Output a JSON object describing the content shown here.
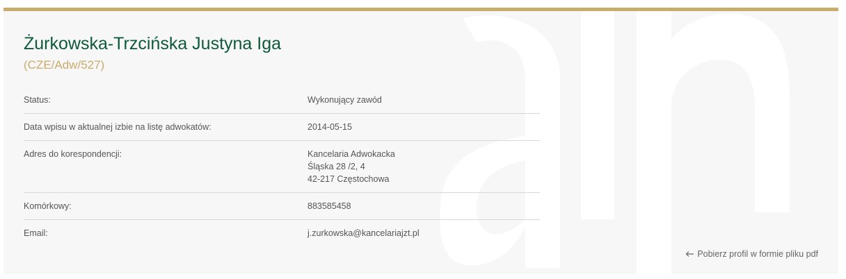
{
  "profile": {
    "name": "Żurkowska-Trzcińska Justyna Iga",
    "code": "(CZE/Adw/527)"
  },
  "details": {
    "status_label": "Status:",
    "status_value": "Wykonujący zawód",
    "entry_date_label": "Data wpisu w aktualnej izbie na listę adwokatów:",
    "entry_date_value": "2014-05-15",
    "address_label": "Adres do korespondencji:",
    "address_lines": [
      "Kancelaria Adwokacka",
      "Śląska 28 /2, 4",
      "42-217 Częstochowa"
    ],
    "mobile_label": "Komórkowy:",
    "mobile_value": "883585458",
    "email_label": "Email:",
    "email_value": "j.zurkowska@kancelariajzt.pl"
  },
  "actions": {
    "pdf_link_label": "Pobierz profil w formie pliku pdf",
    "pdf_link_icon": "arrow-left-icon"
  },
  "colors": {
    "accent_gold": "#c8ab6d",
    "name_green": "#0e5a3a",
    "card_background": "#f7f7f7"
  }
}
